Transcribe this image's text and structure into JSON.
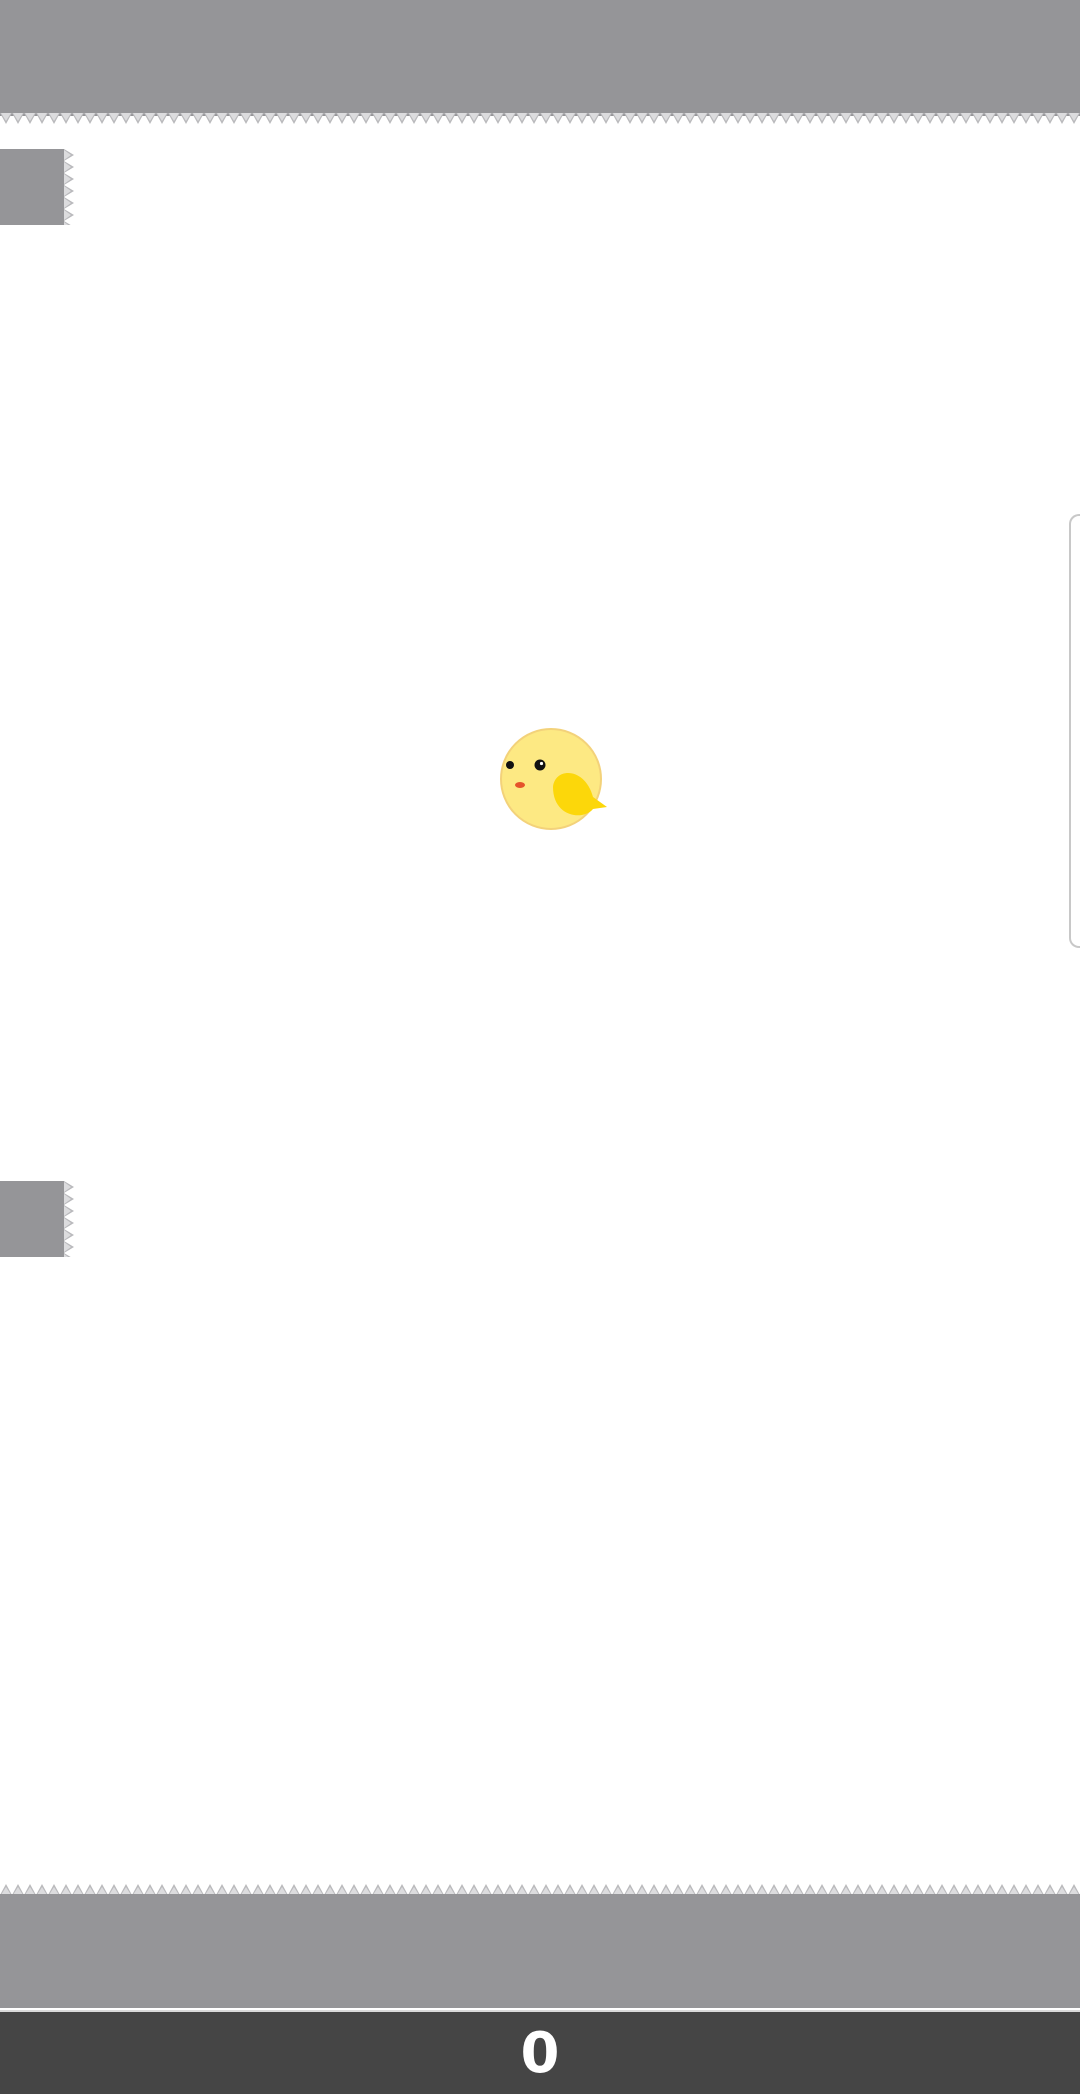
{
  "game": {
    "score": "0"
  },
  "colors": {
    "background": "#ffffff",
    "wall": "#959598",
    "spike": "#c4c4c6",
    "score_bar": "#454545",
    "score_text": "#ffffff",
    "bird_body": "#fde983",
    "bird_wing": "#fcd70a",
    "bird_eye": "#111111",
    "bird_beak": "#e5532b"
  },
  "icons": {
    "player": "yellow-bird-icon",
    "hazard": "spike-icon"
  }
}
